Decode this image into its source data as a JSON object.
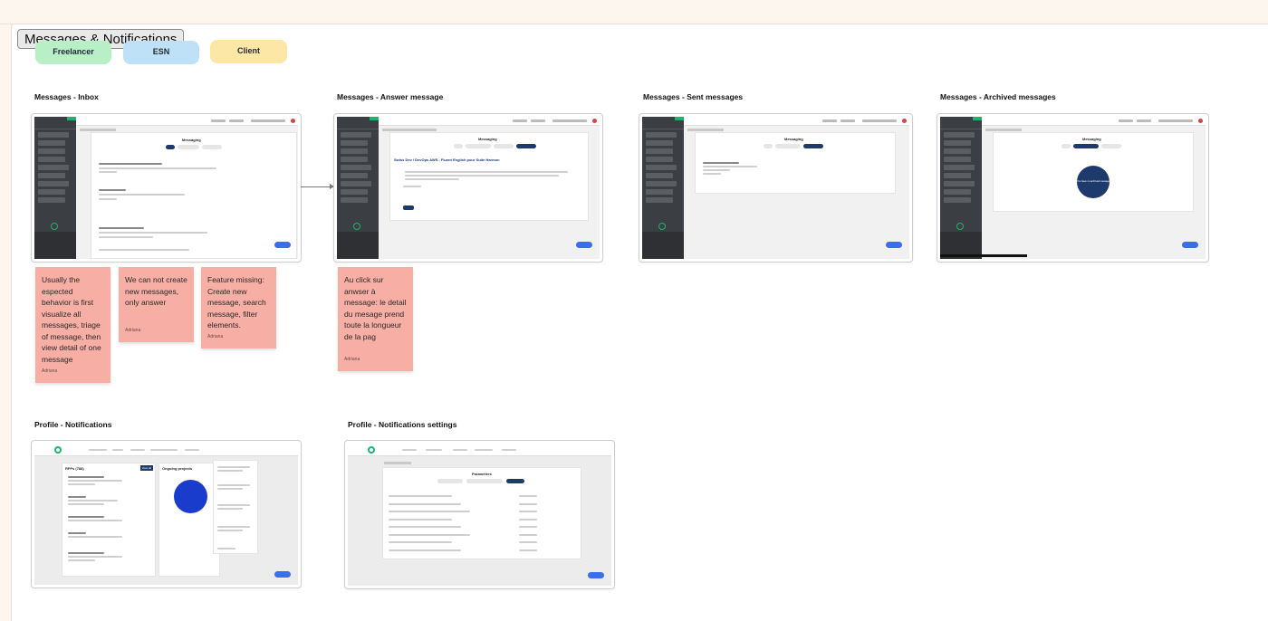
{
  "board": {
    "title": "Messages & Notifications",
    "tags": [
      {
        "label": "Freelancer",
        "color": "#b8efc6"
      },
      {
        "label": "ESN",
        "color": "#bfe1f8"
      },
      {
        "label": "Client",
        "color": "#fde7a6"
      }
    ]
  },
  "frames": {
    "inbox": {
      "label": "Messages - Inbox",
      "heading": "Messaging"
    },
    "answer": {
      "label": "Messages - Answer message",
      "heading": "Messaging",
      "subject": "Swiss Dev / DevOps AWS - Fluent English pour Suite Harmon"
    },
    "sent": {
      "label": "Messages - Sent  messages",
      "heading": "Messaging"
    },
    "archived": {
      "label": "Messages - Archived  messages",
      "heading": "Messaging",
      "empty_text": "You have no archived message"
    },
    "notifications": {
      "label": "Profile - Notifications",
      "rfq_title": "RFPs (788)",
      "ongoing_title": "Ongoing projects",
      "view_all": "View all"
    },
    "settings": {
      "label": "Profile - Notifications  settings",
      "heading": "Paramètres",
      "rows": 8
    }
  },
  "stickies": [
    {
      "text": "Usually the espected behavior is first visualize all messages, triage of message, then view detail of one message",
      "author": "Adriana"
    },
    {
      "text": "We can not create new messages, only answer",
      "author": "Adriana"
    },
    {
      "text": "Feature missing: Create new message, search message, filter elements.",
      "author": "Adriana"
    },
    {
      "text": "Au click sur anwser à message: le detail du mesage prend toute la longueur de la pag",
      "author": "Adriana"
    }
  ],
  "colors": {
    "background": "#fdf6ef",
    "sticky": "#f7aea4",
    "sidebar": "#3b3e42",
    "accent_navy": "#1e3a6d",
    "fab_blue": "#3b6df0",
    "brand_green": "#1bb46b"
  }
}
